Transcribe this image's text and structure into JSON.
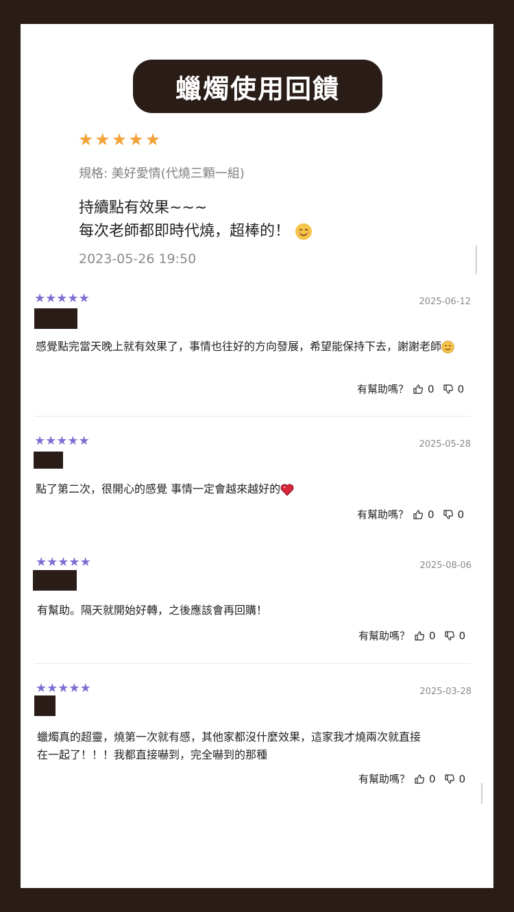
{
  "header": {
    "title": "蠟燭使用回饋"
  },
  "top_review": {
    "stars": [
      "★",
      "★",
      "★",
      "★",
      "★"
    ],
    "rating": 5,
    "spec": "規格: 美好愛情(代燒三顆一組)",
    "text_line1": "持續點有效果~~~",
    "text_line2": "每次老師都即時代燒，超棒的！",
    "emoji": "smiling-face-icon",
    "date": "2023-05-26 19:50"
  },
  "reviews": [
    {
      "stars": [
        "★",
        "★",
        "★",
        "★",
        "★"
      ],
      "rating": 5,
      "date": "2025-06-12",
      "text": "感覺點完當天晚上就有效果了，事情也往好的方向發展，希望能保持下去，謝謝老師",
      "emoji": "smiling-face-icon",
      "helpful_label": "有幫助嗎？",
      "likes": "0",
      "dislikes": "0"
    },
    {
      "stars": [
        "★",
        "★",
        "★",
        "★",
        "★"
      ],
      "rating": 5,
      "date": "2025-05-28",
      "text": "點了第二次，很開心的感覺 事情一定會越來越好的",
      "emoji": "heart-icon",
      "helpful_label": "有幫助嗎？",
      "likes": "0",
      "dislikes": "0"
    },
    {
      "stars": [
        "★",
        "★",
        "★",
        "★",
        "★"
      ],
      "rating": 5,
      "date": "2025-08-06",
      "text": "有幫助。隔天就開始好轉，之後應該會再回購！",
      "helpful_label": "有幫助嗎？",
      "likes": "0",
      "dislikes": "0"
    },
    {
      "stars": [
        "★",
        "★",
        "★",
        "★",
        "★"
      ],
      "rating": 5,
      "date": "2025-03-28",
      "text_line1": "蠟燭真的超靈，燒第一次就有感，其他家都沒什麼效果，這家我才燒兩次就直接",
      "text_line2": "在一起了！！！我都直接嚇到，完全嚇到的那種",
      "helpful_label": "有幫助嗎？",
      "likes": "0",
      "dislikes": "0"
    }
  ],
  "colors": {
    "frame": "#2a1c17",
    "top_star": "#f2a33a",
    "review_star": "#7b6fd4"
  }
}
